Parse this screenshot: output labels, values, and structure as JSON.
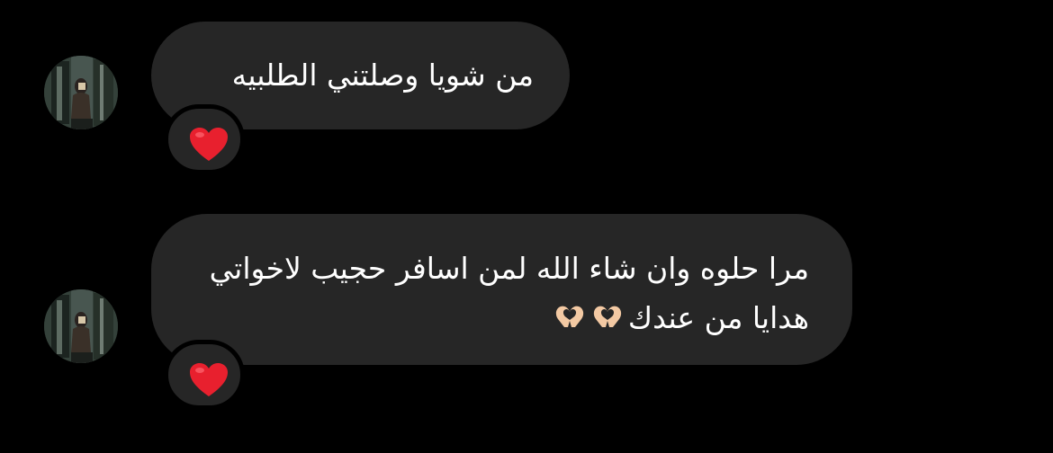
{
  "colors": {
    "background": "#000000",
    "bubble": "#262626",
    "text": "#ffffff",
    "heart": "#e8202e"
  },
  "messages": [
    {
      "lines": [
        "من شويا وصلتني الطلبيه"
      ],
      "reaction": "heart-emoji"
    },
    {
      "lines": [
        "مرا حلوه وان شاء الله لمن اسافر حجيب لاخواتي",
        "هدايا من عندك"
      ],
      "trailing_emoji": "heart-hands-emoji",
      "trailing_emoji_count": 2,
      "reaction": "heart-emoji"
    }
  ]
}
